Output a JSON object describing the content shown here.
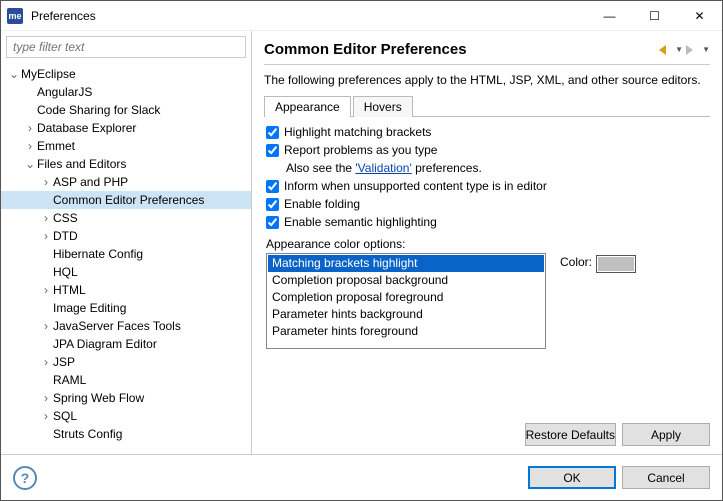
{
  "window": {
    "title": "Preferences",
    "app_icon_text": "me",
    "win_min": "—",
    "win_max": "☐",
    "win_close": "✕"
  },
  "filter_placeholder": "type filter text",
  "tree": [
    {
      "label": "MyEclipse",
      "depth": 0,
      "exp": "v",
      "sel": false
    },
    {
      "label": "AngularJS",
      "depth": 1,
      "exp": "",
      "sel": false
    },
    {
      "label": "Code Sharing for Slack",
      "depth": 1,
      "exp": "",
      "sel": false
    },
    {
      "label": "Database Explorer",
      "depth": 1,
      "exp": ">",
      "sel": false
    },
    {
      "label": "Emmet",
      "depth": 1,
      "exp": ">",
      "sel": false
    },
    {
      "label": "Files and Editors",
      "depth": 1,
      "exp": "v",
      "sel": false
    },
    {
      "label": "ASP and PHP",
      "depth": 2,
      "exp": ">",
      "sel": false
    },
    {
      "label": "Common Editor Preferences",
      "depth": 2,
      "exp": "",
      "sel": true
    },
    {
      "label": "CSS",
      "depth": 2,
      "exp": ">",
      "sel": false
    },
    {
      "label": "DTD",
      "depth": 2,
      "exp": ">",
      "sel": false
    },
    {
      "label": "Hibernate Config",
      "depth": 2,
      "exp": "",
      "sel": false
    },
    {
      "label": "HQL",
      "depth": 2,
      "exp": "",
      "sel": false
    },
    {
      "label": "HTML",
      "depth": 2,
      "exp": ">",
      "sel": false
    },
    {
      "label": "Image Editing",
      "depth": 2,
      "exp": "",
      "sel": false
    },
    {
      "label": "JavaServer Faces Tools",
      "depth": 2,
      "exp": ">",
      "sel": false
    },
    {
      "label": "JPA Diagram Editor",
      "depth": 2,
      "exp": "",
      "sel": false
    },
    {
      "label": "JSP",
      "depth": 2,
      "exp": ">",
      "sel": false
    },
    {
      "label": "RAML",
      "depth": 2,
      "exp": "",
      "sel": false
    },
    {
      "label": "Spring Web Flow",
      "depth": 2,
      "exp": ">",
      "sel": false
    },
    {
      "label": "SQL",
      "depth": 2,
      "exp": ">",
      "sel": false
    },
    {
      "label": "Struts Config",
      "depth": 2,
      "exp": "",
      "sel": false
    }
  ],
  "main": {
    "heading": "Common Editor Preferences",
    "desc": "The following preferences apply to the HTML, JSP, XML, and other source editors.",
    "tabs": {
      "appearance": "Appearance",
      "hovers": "Hovers"
    },
    "checks": {
      "brackets": "Highlight matching brackets",
      "report": "Report problems as you type",
      "also_see": "Also see the ",
      "validation_link": "'Validation'",
      "also_see_tail": " preferences.",
      "inform": "Inform when unsupported content type is in editor",
      "folding": "Enable folding",
      "semantic": "Enable semantic highlighting"
    },
    "color_label": "Appearance color options:",
    "colors": [
      "Matching brackets highlight",
      "Completion proposal background",
      "Completion proposal foreground",
      "Parameter hints background",
      "Parameter hints foreground"
    ],
    "color_text": "Color:",
    "color_value": "#c0c0c0",
    "restore": "Restore Defaults",
    "apply": "Apply"
  },
  "footer": {
    "ok": "OK",
    "cancel": "Cancel"
  }
}
